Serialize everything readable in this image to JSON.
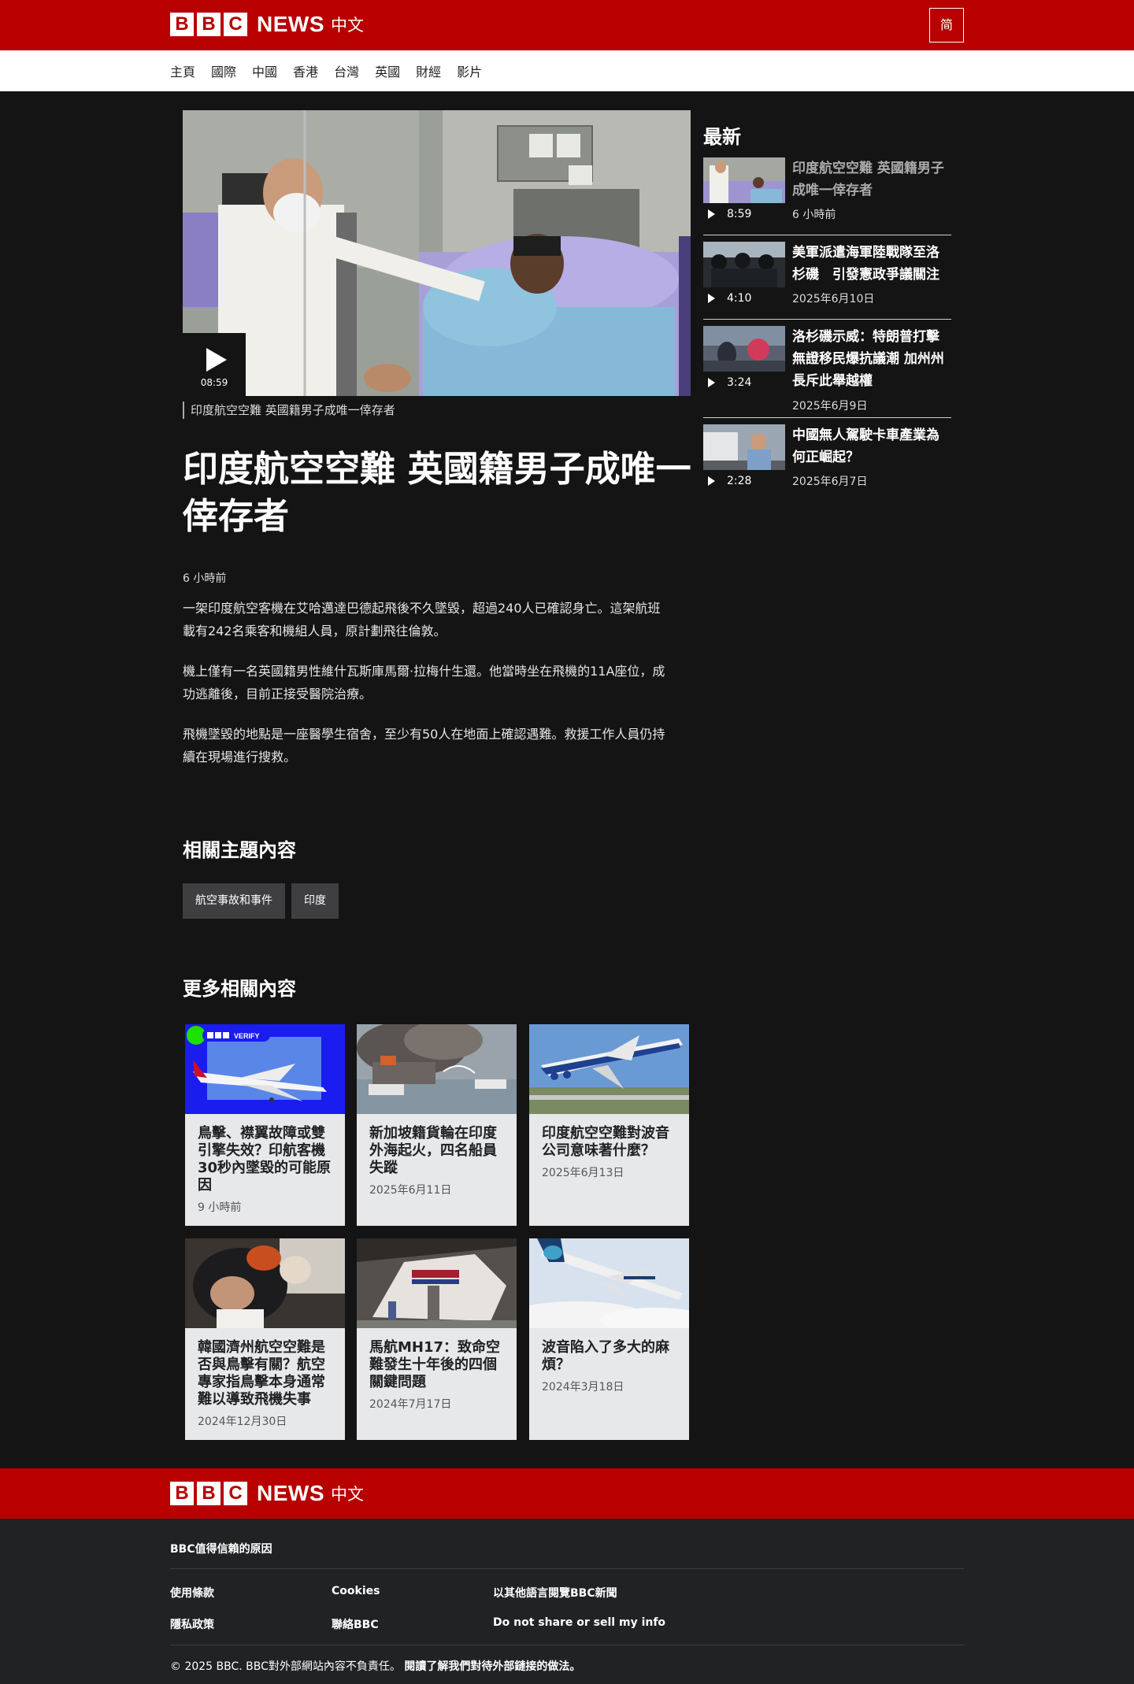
{
  "header": {
    "logo_letters": [
      "B",
      "B",
      "C"
    ],
    "logo_news": "NEWS",
    "logo_zh": "中文",
    "lang_toggle": "简"
  },
  "nav": {
    "items": [
      "主頁",
      "國際",
      "中國",
      "香港",
      "台灣",
      "英國",
      "財經",
      "影片"
    ]
  },
  "article": {
    "video_duration": "08:59",
    "caption": "印度航空空難 英國籍男子成唯一倖存者",
    "headline": "印度航空空難 英國籍男子成唯一倖存者",
    "time": "6 小時前",
    "paragraphs": [
      "一架印度航空客機在艾哈邁達巴德起飛後不久墜毀，超過240人已確認身亡。這架航班載有242名乘客和機組人員，原計劃飛往倫敦。",
      "機上僅有一名英國籍男性維什瓦斯庫馬爾·拉梅什生還。他當時坐在飛機的11A座位，成功逃離後，目前正接受醫院治療。",
      "飛機墜毀的地點是一座醫學生宿舍，至少有50人在地面上確認遇難。救援工作人員仍持續在現場進行搜救。"
    ]
  },
  "topics": {
    "title": "相關主題內容",
    "tags": [
      "航空事故和事件",
      "印度"
    ]
  },
  "more": {
    "title": "更多相關內容",
    "verify_badge": "VERIFY",
    "cards": [
      {
        "title": "鳥擊、襟翼故障或雙引擎失效？印航客機30秒內墜毀的可能原因",
        "date": "9 小時前"
      },
      {
        "title": "新加坡籍貨輪在印度外海起火，四名船員失蹤",
        "date": "2025年6月11日"
      },
      {
        "title": "印度航空空難對波音公司意味著什麼？",
        "date": "2025年6月13日"
      },
      {
        "title": "韓國濟州航空空難是否與鳥擊有關？航空專家指鳥擊本身通常難以導致飛機失事",
        "date": "2024年12月30日"
      },
      {
        "title": "馬航MH17：致命空難發生十年後的四個關鍵問題",
        "date": "2024年7月17日"
      },
      {
        "title": "波音陷入了多大的麻煩？",
        "date": "2024年3月18日"
      }
    ]
  },
  "sidebar": {
    "title": "最新",
    "items": [
      {
        "title": "印度航空空難 英國籍男子成唯一倖存者",
        "duration": "8:59",
        "date": "6 小時前"
      },
      {
        "title": "美軍派遣海軍陸戰隊至洛杉磯　引發憲政爭議關注",
        "duration": "4:10",
        "date": "2025年6月10日"
      },
      {
        "title": "洛杉磯示威：特朗普打擊無證移民爆抗議潮 加州州長斥此舉越權",
        "duration": "3:24",
        "date": "2025年6月9日"
      },
      {
        "title": "中國無人駕駛卡車產業為何正崛起？",
        "duration": "2:28",
        "date": "2025年6月7日"
      }
    ]
  },
  "footer": {
    "why_trust": "BBC值得信賴的原因",
    "links": [
      "使用條款",
      "Cookies",
      "以其他語言閱覽BBC新聞",
      "隱私政策",
      "聯絡BBC",
      "Do not share or sell my info"
    ],
    "copyright": "© 2025 BBC. BBC對外部網站內容不負責任。",
    "external_link": "閱讀了解我們對待外部鏈接的做法。"
  },
  "colors": {
    "brand_red": "#b80000",
    "page_bg": "#141414",
    "card_bg": "#e6e8ea",
    "footer_bg": "#202224"
  }
}
